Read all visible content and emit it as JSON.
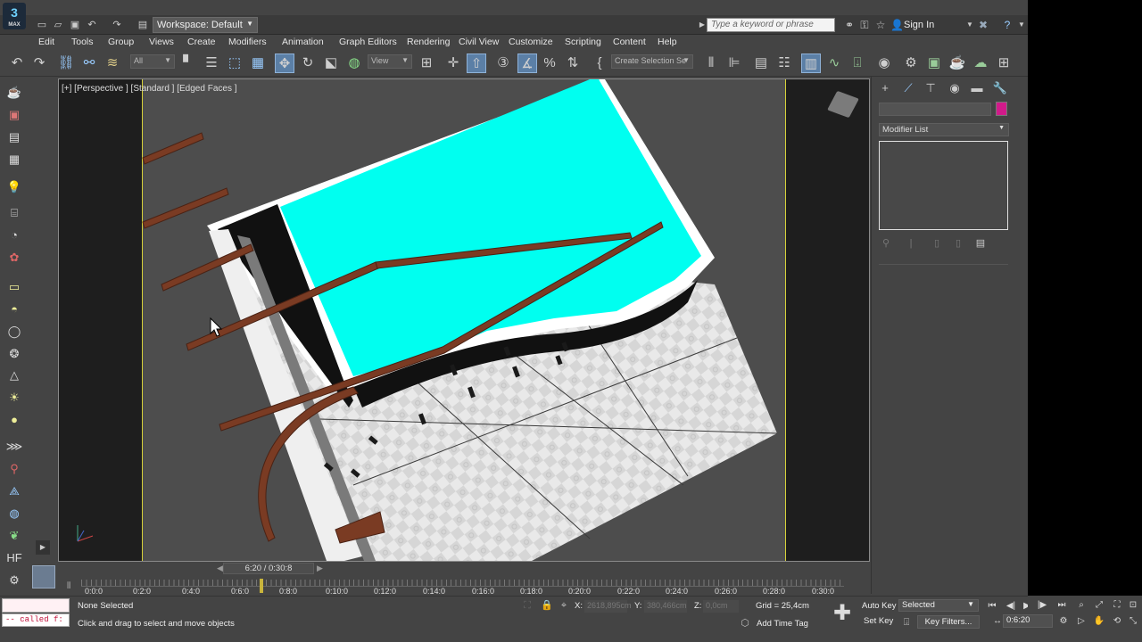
{
  "app": {
    "logo": "3",
    "logo_sub": "MAX",
    "workspace": "Workspace: Default",
    "search_placeholder": "Type a keyword or phrase",
    "sign_in": "Sign In"
  },
  "menu": [
    "Edit",
    "Tools",
    "Group",
    "Views",
    "Create",
    "Modifiers",
    "Animation",
    "Graph Editors",
    "Rendering",
    "Civil View",
    "Customize",
    "Scripting",
    "Content",
    "Help"
  ],
  "toolbar": {
    "filter": "All",
    "ref_coord": "View",
    "selection_set": "Create Selection Se"
  },
  "viewport": {
    "label": "[+] [Perspective ] [Standard ] [Edged Faces ]"
  },
  "command_panel": {
    "object_color": "#d11a8a",
    "modifier_list": "Modifier List"
  },
  "timeline": {
    "frame_display": "6:20 / 0:30:8",
    "ticks": [
      "0:0:0",
      "0:2:0",
      "0:4:0",
      "0:6:0",
      "0:8:0",
      "0:10:0",
      "0:12:0",
      "0:14:0",
      "0:16:0",
      "0:18:0",
      "0:20:0",
      "0:22:0",
      "0:24:0",
      "0:26:0",
      "0:28:0",
      "0:30:0"
    ]
  },
  "status": {
    "maxscript_output": "-- called f:",
    "selection": "None Selected",
    "prompt": "Click and drag to select and move objects",
    "x_label": "X:",
    "x_value": "2618,895cm",
    "y_label": "Y:",
    "y_value": "380,466cm",
    "z_label": "Z:",
    "z_value": "0,0cm",
    "grid": "Grid = 25,4cm",
    "add_time_tag": "Add Time Tag",
    "auto_key": "Auto Key",
    "set_key": "Set Key",
    "key_mode": "Selected",
    "key_filters": "Key Filters...",
    "current_frame": "0:6:20"
  },
  "colors": {
    "pool_water": "#00fff0",
    "wood": "#7a3b23",
    "ui_bg": "#444444",
    "safe_frame": "#d6d13a"
  }
}
